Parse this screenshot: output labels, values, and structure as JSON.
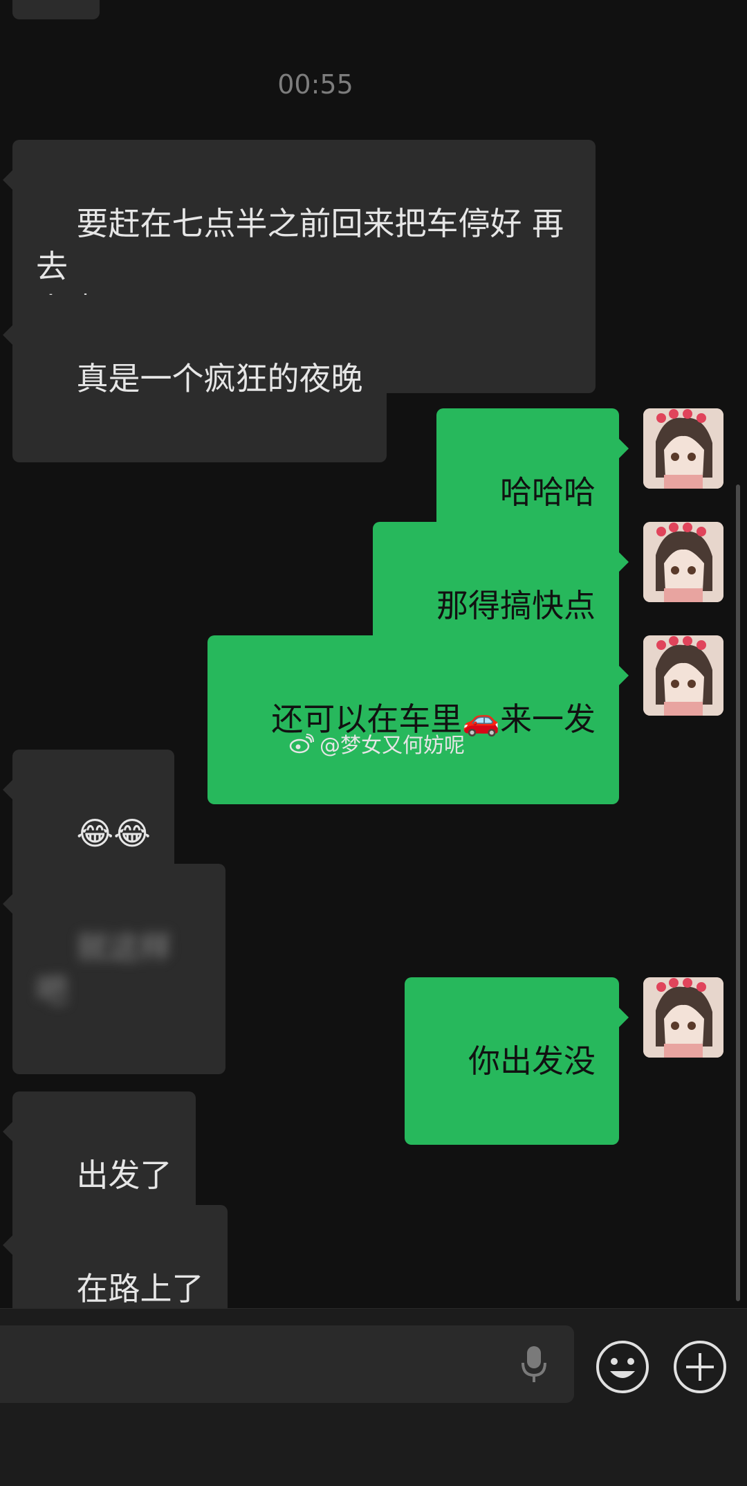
{
  "chat": {
    "timestamp": "00:55",
    "messages": [
      {
        "side": "recv",
        "text": "要赶在七点半之前回来把车停好 再去\n上班"
      },
      {
        "side": "recv",
        "text": "真是一个疯狂的夜晚"
      },
      {
        "side": "sent",
        "text": "哈哈哈"
      },
      {
        "side": "sent",
        "text": "那得搞快点"
      },
      {
        "side": "sent",
        "text": "还可以在车里",
        "emoji": "🚗",
        "text_after": "来一发"
      },
      {
        "side": "recv",
        "text": "😂😂"
      },
      {
        "side": "recv",
        "text": "就这样吧",
        "blurred": true
      },
      {
        "side": "sent",
        "text": "你出发没"
      },
      {
        "side": "recv",
        "text": "出发了"
      },
      {
        "side": "recv",
        "text": "在路上了"
      }
    ],
    "watermark": "@梦女又何妨呢"
  },
  "input_bar": {
    "placeholder": "",
    "icons": [
      "microphone-icon",
      "emoji-icon",
      "plus-icon"
    ]
  },
  "colors": {
    "background": "#111111",
    "received_bubble": "#2c2c2c",
    "sent_bubble": "#27b85c"
  }
}
